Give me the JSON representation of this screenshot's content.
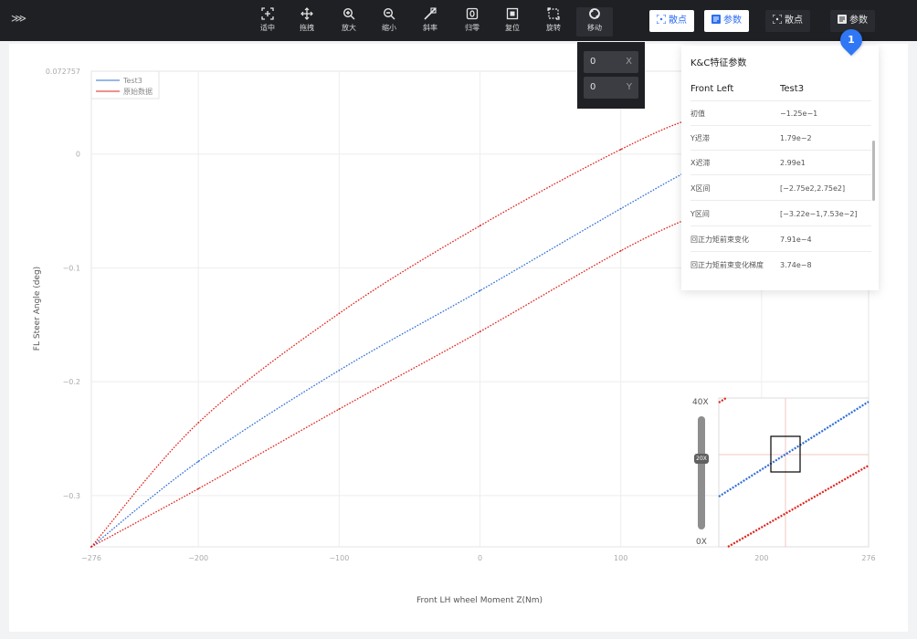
{
  "toolbar": {
    "collapse_icon": "collapse-left-icon",
    "tools": [
      {
        "label": "适中",
        "icon": "fit-icon"
      },
      {
        "label": "拖拽",
        "icon": "drag-icon"
      },
      {
        "label": "放大",
        "icon": "zoom-in-icon"
      },
      {
        "label": "缩小",
        "icon": "zoom-out-icon"
      },
      {
        "label": "斜率",
        "icon": "slope-icon"
      },
      {
        "label": "归零",
        "icon": "zero-icon"
      },
      {
        "label": "复位",
        "icon": "reset-icon"
      },
      {
        "label": "旋转",
        "icon": "rotate-icon"
      },
      {
        "label": "移动",
        "icon": "move-icon"
      }
    ],
    "right_buttons": [
      {
        "label": "散点",
        "icon": "scatter-icon"
      },
      {
        "label": "参数",
        "icon": "param-icon"
      },
      {
        "label": "散点",
        "icon": "scatter-icon"
      },
      {
        "label": "参数",
        "icon": "param-icon"
      }
    ]
  },
  "move_panel": {
    "x_value": "0",
    "x_axis": "X",
    "y_value": "0",
    "y_axis": "Y"
  },
  "param_panel": {
    "title": "K&C特征参数",
    "header": {
      "key": "Front Left",
      "value": "Test3"
    },
    "rows": [
      {
        "key": "初值",
        "value": "−1.25e−1"
      },
      {
        "key": "Y迟滞",
        "value": "1.79e−2"
      },
      {
        "key": "X迟滞",
        "value": "2.99e1"
      },
      {
        "key": "X区间",
        "value": "[−2.75e2,2.75e2]"
      },
      {
        "key": "Y区间",
        "value": "[−3.22e−1,7.53e−2]"
      },
      {
        "key": "回正力矩前束变化",
        "value": "7.91e−4"
      },
      {
        "key": "回正力矩前束变化梯度",
        "value": "3.74e−8"
      }
    ]
  },
  "badge": "1",
  "zoom": {
    "max_label": "40X",
    "current_label": "20X",
    "min_label": "0X",
    "level": 0.5
  },
  "colors": {
    "toolbar_bg": "#1f2024",
    "accent": "#2f77f5",
    "test3": "#2f6fd6",
    "raw": "#e0211b"
  },
  "chart_data": {
    "type": "scatter",
    "xlabel": "Front LH wheel Moment Z(Nm)",
    "ylabel": "FL Steer Angle (deg)",
    "xlim": [
      -276,
      276
    ],
    "ylim": [
      -0.345,
      0.072757
    ],
    "x_ticks": [
      "−276",
      "−200",
      "−100",
      "0",
      "100",
      "200",
      "276"
    ],
    "x_tick_values": [
      -276,
      -200,
      -100,
      0,
      100,
      200,
      276
    ],
    "y_ticks": [
      "0.072757",
      "0",
      "−0.1",
      "−0.2",
      "−0.3"
    ],
    "y_tick_values": [
      0.072757,
      0,
      -0.1,
      -0.2,
      -0.3
    ],
    "grid": true,
    "legend": "top-left",
    "series": [
      {
        "name": "Test3",
        "color": "#2f6fd6",
        "x": [
          -276,
          -200,
          -100,
          0,
          100,
          160,
          238
        ],
        "y": [
          -0.345,
          -0.27,
          -0.19,
          -0.12,
          -0.048,
          -0.007,
          0.038
        ]
      },
      {
        "name": "原始数据",
        "color": "#e0211b",
        "x": [
          -276,
          -200,
          -100,
          0,
          100,
          160,
          238
        ],
        "y": [
          -0.345,
          -0.236,
          -0.14,
          -0.063,
          0.004,
          0.035,
          0.057
        ]
      },
      {
        "name": "原始数据",
        "color": "#e0211b",
        "x": [
          -276,
          -200,
          -100,
          0,
          100,
          160,
          238
        ],
        "y": [
          -0.345,
          -0.294,
          -0.224,
          -0.156,
          -0.085,
          -0.05,
          -0.01
        ]
      }
    ]
  }
}
